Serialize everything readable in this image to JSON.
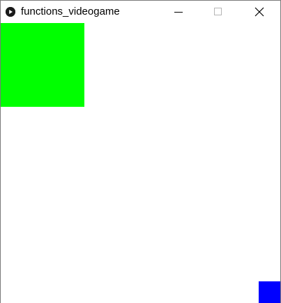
{
  "window": {
    "title": "functions_videogame",
    "icon": "play-circle-icon",
    "controls": [
      "minimize-icon",
      "maximize-icon",
      "close-icon"
    ]
  },
  "canvas": {
    "background": "#ffffff",
    "player_square": {
      "color": "#00ff00"
    },
    "target_square": {
      "color": "#0000ff"
    }
  }
}
